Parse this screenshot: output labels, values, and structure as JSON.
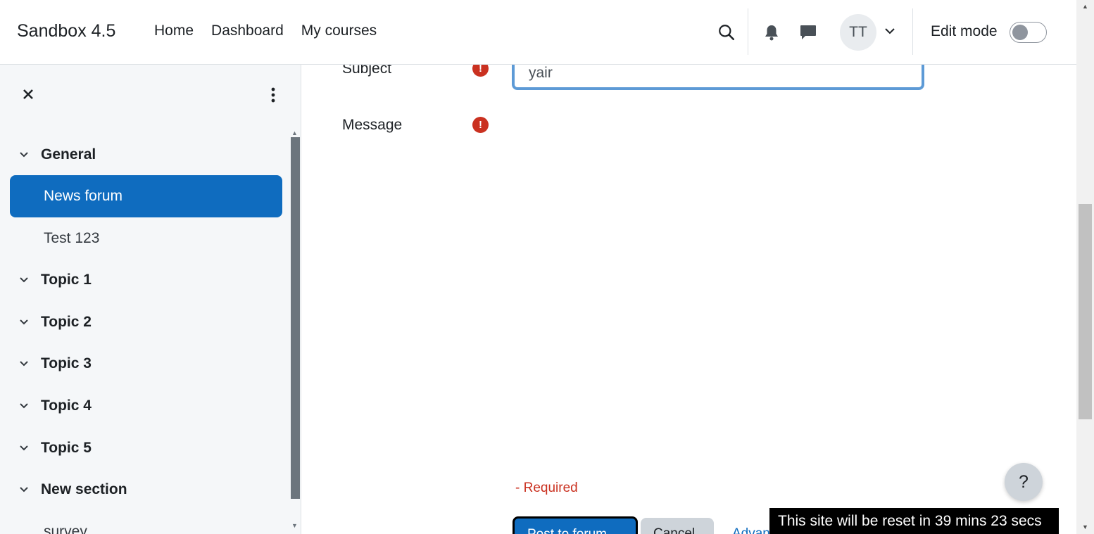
{
  "navbar": {
    "brand": "Sandbox 4.5",
    "links": [
      "Home",
      "Dashboard",
      "My courses"
    ],
    "avatar_initials": "TT",
    "edit_mode_label": "Edit mode",
    "edit_mode_on": false
  },
  "sidebar": {
    "items": [
      {
        "type": "section",
        "label": "General"
      },
      {
        "type": "activity",
        "label": "News forum",
        "active": true
      },
      {
        "type": "activity",
        "label": "Test 123"
      },
      {
        "type": "section",
        "label": "Topic 1"
      },
      {
        "type": "section",
        "label": "Topic 2"
      },
      {
        "type": "section",
        "label": "Topic 3"
      },
      {
        "type": "section",
        "label": "Topic 4"
      },
      {
        "type": "section",
        "label": "Topic 5"
      },
      {
        "type": "section",
        "label": "New section"
      },
      {
        "type": "activity",
        "label": "survey"
      }
    ]
  },
  "form": {
    "subject_label": "Subject",
    "subject_value": "yair",
    "message_label": "Message",
    "required_icon": "!",
    "required_note": "- Required",
    "post_button": "Post to forum",
    "cancel_button": "Cancel",
    "advanced_link": "Advanced"
  },
  "help_button": "?",
  "reset_notice": "This site will be reset in 39 mins 23 secs",
  "colors": {
    "primary": "#0f6cbf",
    "danger": "#ca3120",
    "sidebar_bg": "#f5f7f9"
  }
}
